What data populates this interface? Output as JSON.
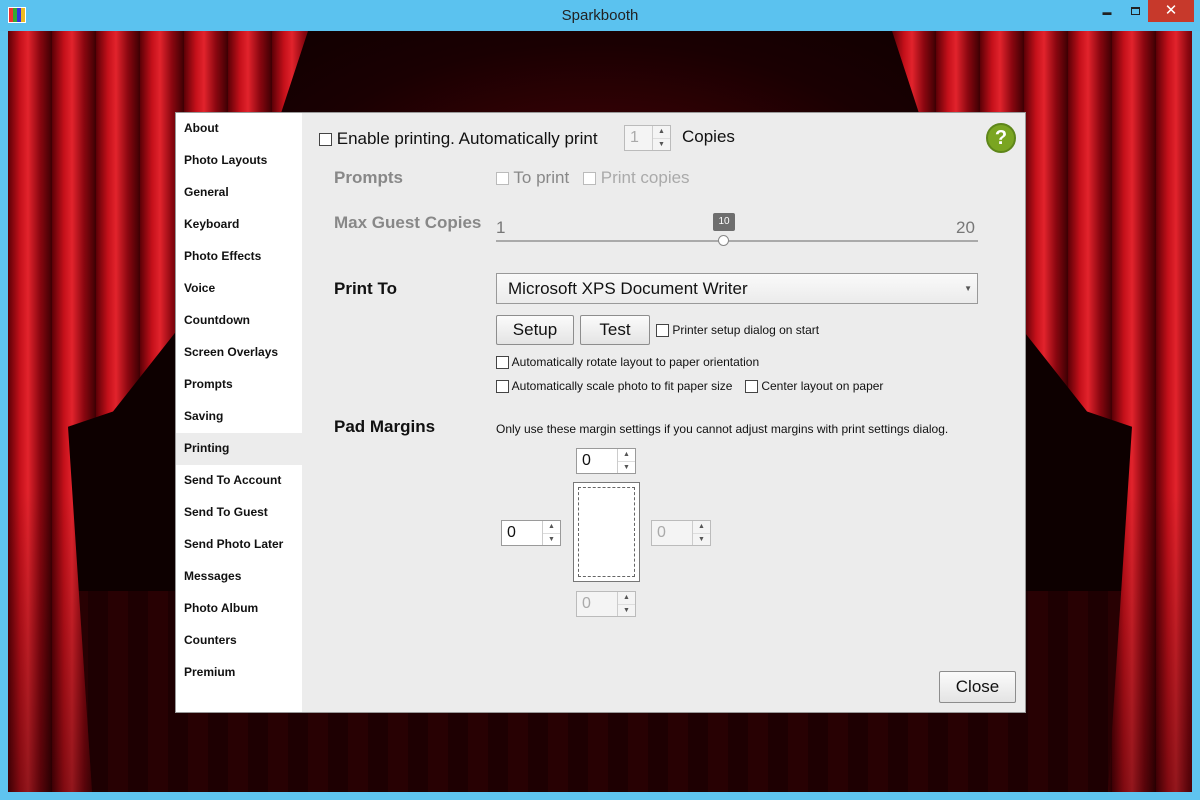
{
  "window": {
    "title": "Sparkbooth",
    "min_glyph": "▬",
    "close_glyph": "✕"
  },
  "sidebar": {
    "items": [
      {
        "label": "About"
      },
      {
        "label": "Photo Layouts"
      },
      {
        "label": "General"
      },
      {
        "label": "Keyboard"
      },
      {
        "label": "Photo Effects"
      },
      {
        "label": "Voice"
      },
      {
        "label": "Countdown"
      },
      {
        "label": "Screen Overlays"
      },
      {
        "label": "Prompts"
      },
      {
        "label": "Saving"
      },
      {
        "label": "Printing"
      },
      {
        "label": "Send To Account"
      },
      {
        "label": "Send To Guest"
      },
      {
        "label": "Send Photo Later"
      },
      {
        "label": "Messages"
      },
      {
        "label": "Photo Album"
      },
      {
        "label": "Counters"
      },
      {
        "label": "Premium"
      }
    ],
    "active": "Printing"
  },
  "printing": {
    "enable_label": "Enable printing. Automatically print",
    "copies_value": "1",
    "copies_label": "Copies",
    "help_glyph": "?",
    "prompts_label": "Prompts",
    "to_print_label": "To print",
    "print_copies_label": "Print copies",
    "max_guest_label": "Max Guest Copies",
    "slider_min": "1",
    "slider_max": "20",
    "slider_value": "10",
    "slider_fraction": 0.474,
    "print_to_label": "Print To",
    "printer_selected": "Microsoft XPS Document Writer",
    "setup_button": "Setup",
    "test_button": "Test",
    "printer_setup_label": "Printer setup dialog on start",
    "auto_rotate_label": "Automatically rotate layout to paper orientation",
    "auto_scale_label": "Automatically scale photo to fit paper size",
    "center_layout_label": "Center layout on paper",
    "pad_margins_label": "Pad Margins",
    "pad_note": "Only use these margin settings if you cannot adjust margins with print settings dialog.",
    "margin_top": "0",
    "margin_left": "0",
    "margin_right": "0",
    "margin_bottom": "0",
    "close_button": "Close"
  },
  "colors": {
    "accent": "#5bc2ef",
    "close_red": "#c7392b",
    "help_green": "#7aa521"
  }
}
